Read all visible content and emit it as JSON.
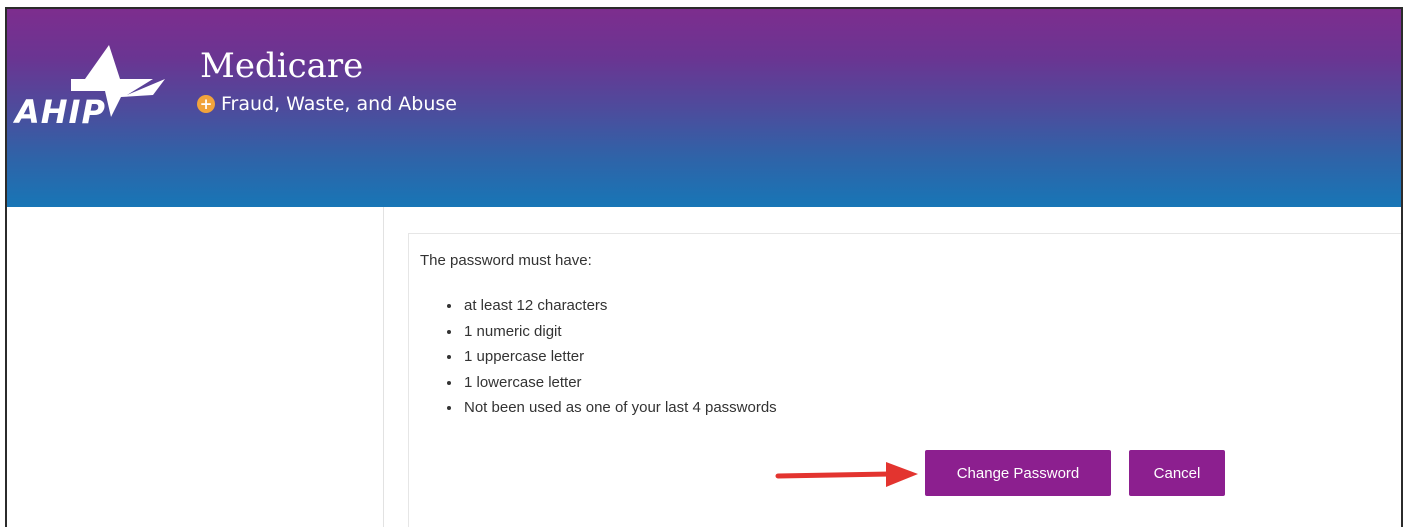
{
  "header": {
    "logo_text": "AHIP",
    "title": "Medicare",
    "subtitle": "Fraud, Waste, and Abuse",
    "subtitle_icon": "plus-circle-icon",
    "colors": {
      "gradient_top": "#7d2d8e",
      "gradient_bottom": "#1876b6",
      "accent": "#f1a33b"
    }
  },
  "password_rules": {
    "intro": "The password must have:",
    "items": [
      "at least 12 characters",
      "1 numeric digit",
      "1 uppercase letter",
      "1 lowercase letter",
      "Not been used as one of your last 4 passwords"
    ]
  },
  "actions": {
    "change_password_label": "Change Password",
    "cancel_label": "Cancel",
    "button_color": "#8c1f8f",
    "pointer": "red-arrow-icon",
    "pointer_color": "#e3342f"
  }
}
